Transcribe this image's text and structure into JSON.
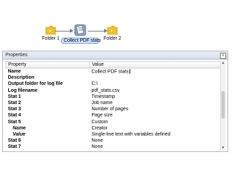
{
  "flow": {
    "nodes": [
      {
        "label": "Folder 1",
        "icon": "folder-icon"
      },
      {
        "label": "Collect PDF stats",
        "icon": "pdf-stats-icon"
      },
      {
        "label": "Folder 2",
        "icon": "folder-icon"
      }
    ]
  },
  "panel": {
    "title": "Properties",
    "close_glyph": "x",
    "columns": {
      "property": "Property",
      "value": "Value"
    },
    "rows": [
      {
        "key": "Name",
        "value": "Collect PDF stats"
      },
      {
        "key": "Description",
        "value": ""
      },
      {
        "key": "Output folder for log file",
        "value": "C:\\"
      },
      {
        "key": "Log filename",
        "value": "pdf_stats.csv"
      },
      {
        "key": "Stat 1",
        "value": "Timestamp"
      },
      {
        "key": "Stat 2",
        "value": "Job name"
      },
      {
        "key": "Stat 3",
        "value": "Number of pages"
      },
      {
        "key": "Stat 4",
        "value": "Page size"
      },
      {
        "key": "Stat 5",
        "value": "Custom"
      },
      {
        "key": "Name",
        "value": "Creator"
      },
      {
        "key": "Value",
        "value": "Single-line text with variables defined"
      },
      {
        "key": "Stat 6",
        "value": "None"
      },
      {
        "key": "Stat 7",
        "value": "None"
      }
    ]
  },
  "colors": {
    "folder": "#f2c12e",
    "selection": "#cfe0ff",
    "panel_header": "#dbe3f1"
  }
}
